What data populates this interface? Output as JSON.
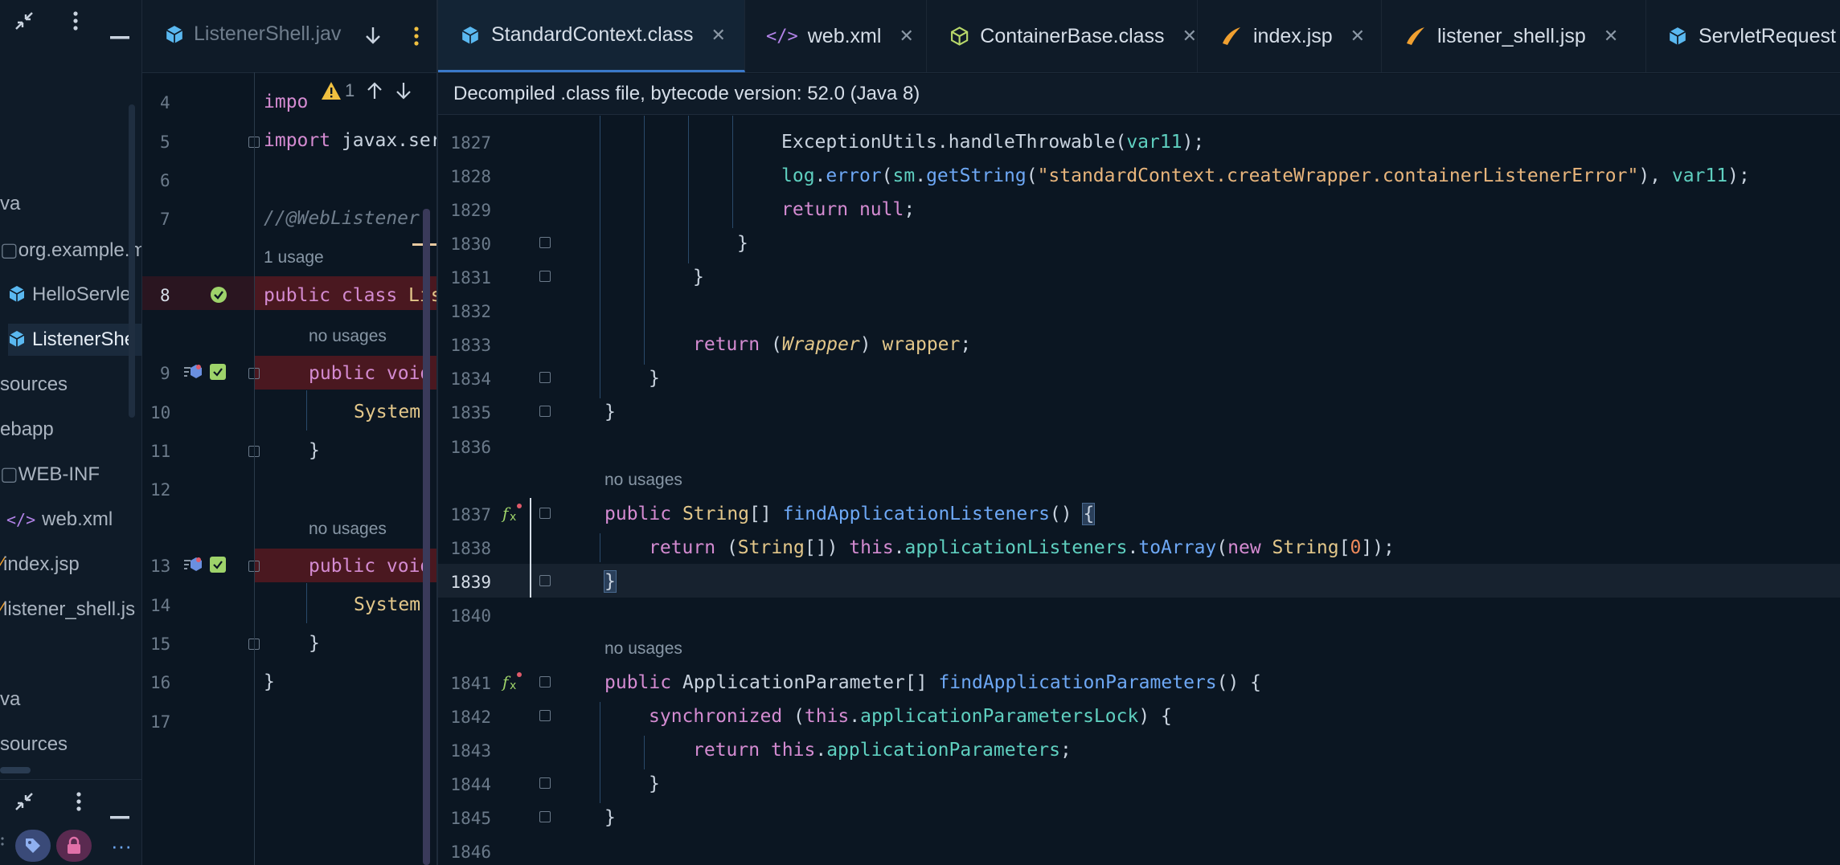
{
  "project_panel": {
    "items": [
      {
        "label": "va"
      },
      {
        "label": "org.example.m"
      },
      {
        "label": "HelloServle"
      },
      {
        "label": "ListenerShe"
      },
      {
        "label": "sources"
      },
      {
        "label": "ebapp"
      },
      {
        "label": "WEB-INF"
      },
      {
        "label": "web.xml"
      },
      {
        "label": "index.jsp"
      },
      {
        "label": "listener_shell.js"
      },
      {
        "label": "va"
      },
      {
        "label": "sources"
      }
    ],
    "bottom_more": "···"
  },
  "left_editor": {
    "tab_label": "ListenerShell.jav",
    "inspection_count": "1",
    "lines": {
      "n4": "4",
      "n5": "5",
      "n6": "6",
      "n7": "7",
      "n8": "8",
      "n9": "9",
      "n10": "10",
      "n11": "11",
      "n12": "12",
      "n13": "13",
      "n14": "14",
      "n15": "15",
      "n16": "16",
      "n17": "17"
    },
    "code": {
      "l4_kw": "impo",
      "l5_kw": "import",
      "l5_rest": " javax.ser",
      "l7_comment": "//@WebListener",
      "usage_1": "1 usage",
      "l8_kw": "public class ",
      "l8_name": "Lis",
      "usage_2": "no usages",
      "l9_kw": "public void",
      "l10": "System.",
      "l11": "}",
      "usage_3": "no usages",
      "l13_kw": "public void",
      "l14": "System.",
      "l15": "}",
      "l16": "}"
    }
  },
  "tabs": [
    {
      "label": "StandardContext.class",
      "active": true
    },
    {
      "label": "web.xml"
    },
    {
      "label": "ContainerBase.class"
    },
    {
      "label": "index.jsp"
    },
    {
      "label": "listener_shell.jsp"
    },
    {
      "label": "ServletRequest"
    }
  ],
  "banner": "Decompiled .class file, bytecode version: 52.0 (Java 8)",
  "colors": {
    "accent": "#3a78c9",
    "background": "#0b1622",
    "panel": "#0f1b28",
    "error_line": "#4a1820"
  },
  "code": {
    "ln": {
      "n1827": "1827",
      "n1828": "1828",
      "n1829": "1829",
      "n1830": "1830",
      "n1831": "1831",
      "n1832": "1832",
      "n1833": "1833",
      "n1834": "1834",
      "n1835": "1835",
      "n1836": "1836",
      "n1837": "1837",
      "n1838": "1838",
      "n1839": "1839",
      "n1840": "1840",
      "n1841": "1841",
      "n1842": "1842",
      "n1843": "1843",
      "n1844": "1844",
      "n1845": "1845",
      "n1846": "1846"
    },
    "l1827": {
      "a": "ExceptionUtils",
      "b": ".",
      "c": "handleThrowable",
      "d": "(",
      "e": "var11",
      "f": ");"
    },
    "l1828": {
      "a": "log",
      "b": ".",
      "c": "error",
      "d": "(",
      "e": "sm",
      "f": ".",
      "g": "getString",
      "h": "(",
      "i": "\"standardContext.createWrapper.containerListenerError\"",
      "j": "), ",
      "k": "var11",
      "l": ");"
    },
    "l1829": {
      "a": "return ",
      "b": "null",
      "c": ";"
    },
    "l1830": "}",
    "l1831": "}",
    "l1833": {
      "a": "return ",
      "b": "(",
      "c": "Wrapper",
      "d": ") ",
      "e": "wrapper",
      "f": ";"
    },
    "l1834": "}",
    "l1835": "}",
    "usage_a": "no usages",
    "l1837": {
      "a": "public ",
      "b": "String",
      "c": "[] ",
      "d": "findApplicationListeners",
      "e": "() ",
      "f": "{"
    },
    "l1838": {
      "a": "return ",
      "b": "(",
      "c": "String",
      "d": "[]) ",
      "e": "this",
      "f": ".",
      "g": "applicationListeners",
      "h": ".",
      "i": "toArray",
      "j": "(",
      "k": "new ",
      "l": "String",
      "m": "[",
      "n": "0",
      "o": "]);"
    },
    "l1839": "}",
    "usage_b": "no usages",
    "l1841": {
      "a": "public ",
      "b": "ApplicationParameter",
      "c": "[] ",
      "d": "findApplicationParameters",
      "e": "() {"
    },
    "l1842": {
      "a": "synchronized ",
      "b": "(",
      "c": "this",
      "d": ".",
      "e": "applicationParametersLock",
      "f": ") {"
    },
    "l1843": {
      "a": "return ",
      "b": "this",
      "c": ".",
      "d": "applicationParameters",
      "e": ";"
    },
    "l1844": "}",
    "l1845": "}"
  }
}
